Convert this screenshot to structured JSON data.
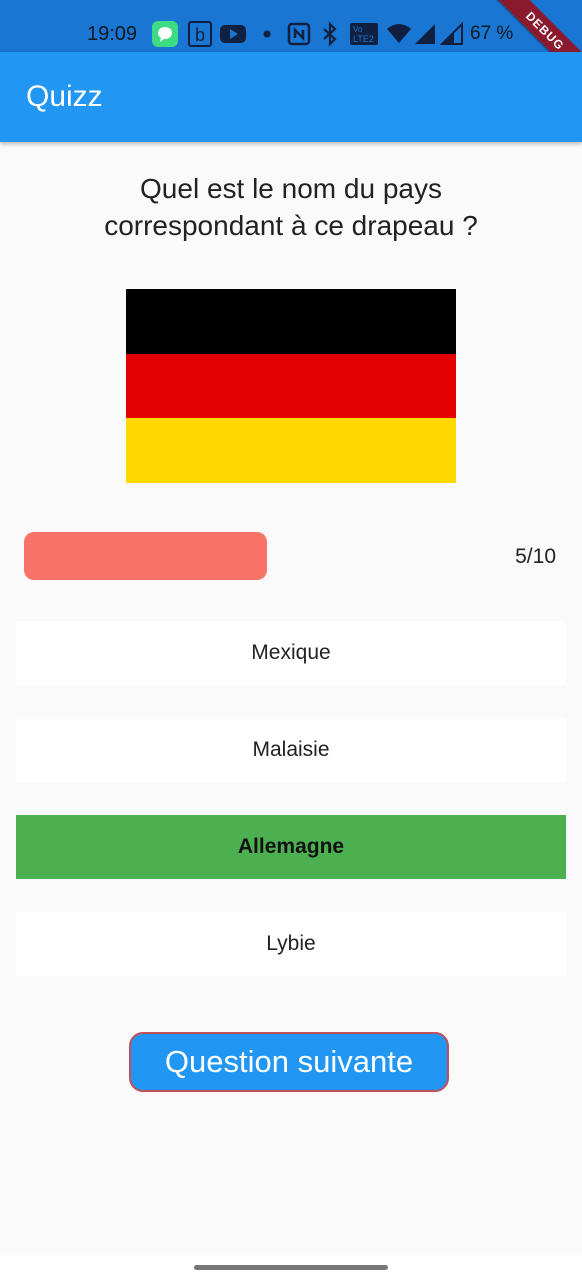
{
  "status_bar": {
    "time": "19:09",
    "icons": [
      "messages-icon",
      "b-app-icon",
      "youtube-icon",
      "dot-icon",
      "nfc-icon",
      "bluetooth-icon",
      "volte-icon",
      "wifi-icon",
      "signal-icon",
      "signal-icon"
    ],
    "battery_text": "67 %",
    "volte_label": "Vo LTE2",
    "debug_label": "DEBUG"
  },
  "app_bar": {
    "title": "Quizz"
  },
  "quiz": {
    "question_line1": "Quel est le nom du pays",
    "question_line2": "correspondant à ce drapeau ?",
    "flag_colors": [
      "#000000",
      "#e30000",
      "#ffd800"
    ],
    "progress": {
      "fraction": 0.5,
      "text": "5/10",
      "color": "#f77368"
    },
    "answers": [
      {
        "label": "Mexique",
        "state": "default"
      },
      {
        "label": "Malaisie",
        "state": "default"
      },
      {
        "label": "Allemagne",
        "state": "correct"
      },
      {
        "label": "Lybie",
        "state": "default"
      }
    ],
    "correct_color": "#4caf50",
    "next_button_label": "Question suivante"
  }
}
